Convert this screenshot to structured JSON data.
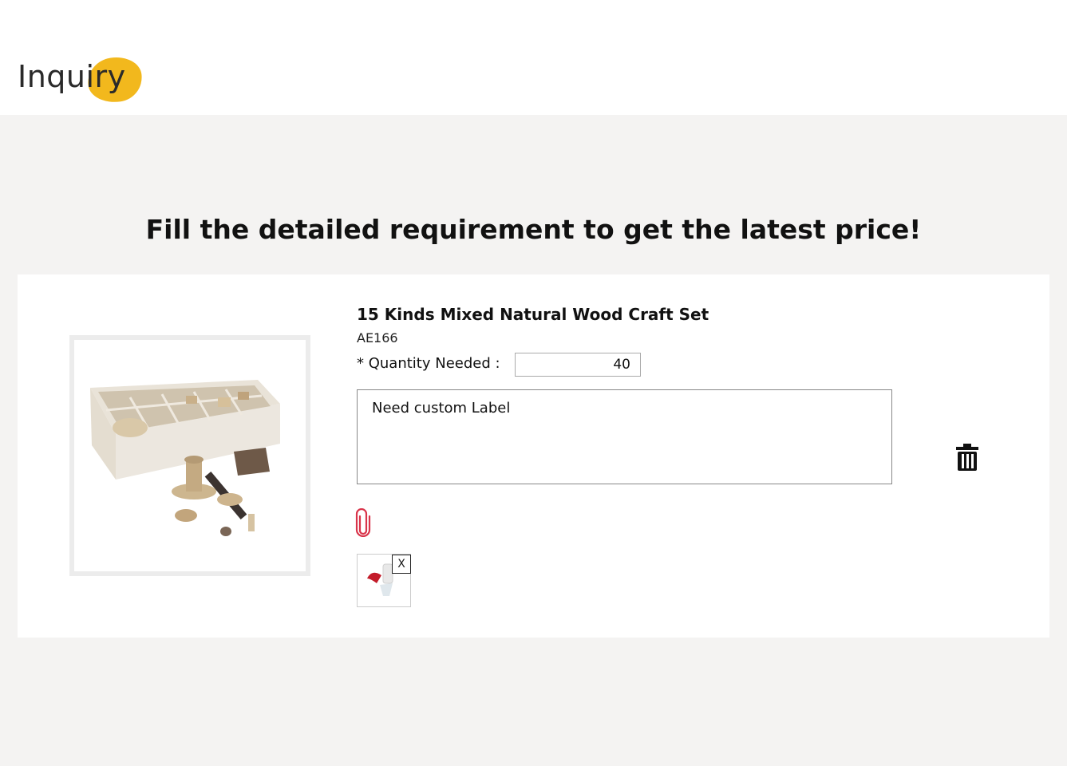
{
  "header": {
    "logo_text": "Inquiry"
  },
  "headline": "Fill the detailed requirement to get the latest price!",
  "product": {
    "title": "15 Kinds Mixed Natural Wood Craft Set",
    "sku": "AE166",
    "quantity_label": "* Quantity Needed :",
    "quantity_value": "40",
    "note_value": "Need custom Label",
    "attachment_icon": "paperclip-icon",
    "delete_icon": "trash-icon",
    "remove_label": "X"
  },
  "colors": {
    "logo_accent": "#f2b81d",
    "clip": "#d9344a",
    "background": "#f4f3f2"
  }
}
